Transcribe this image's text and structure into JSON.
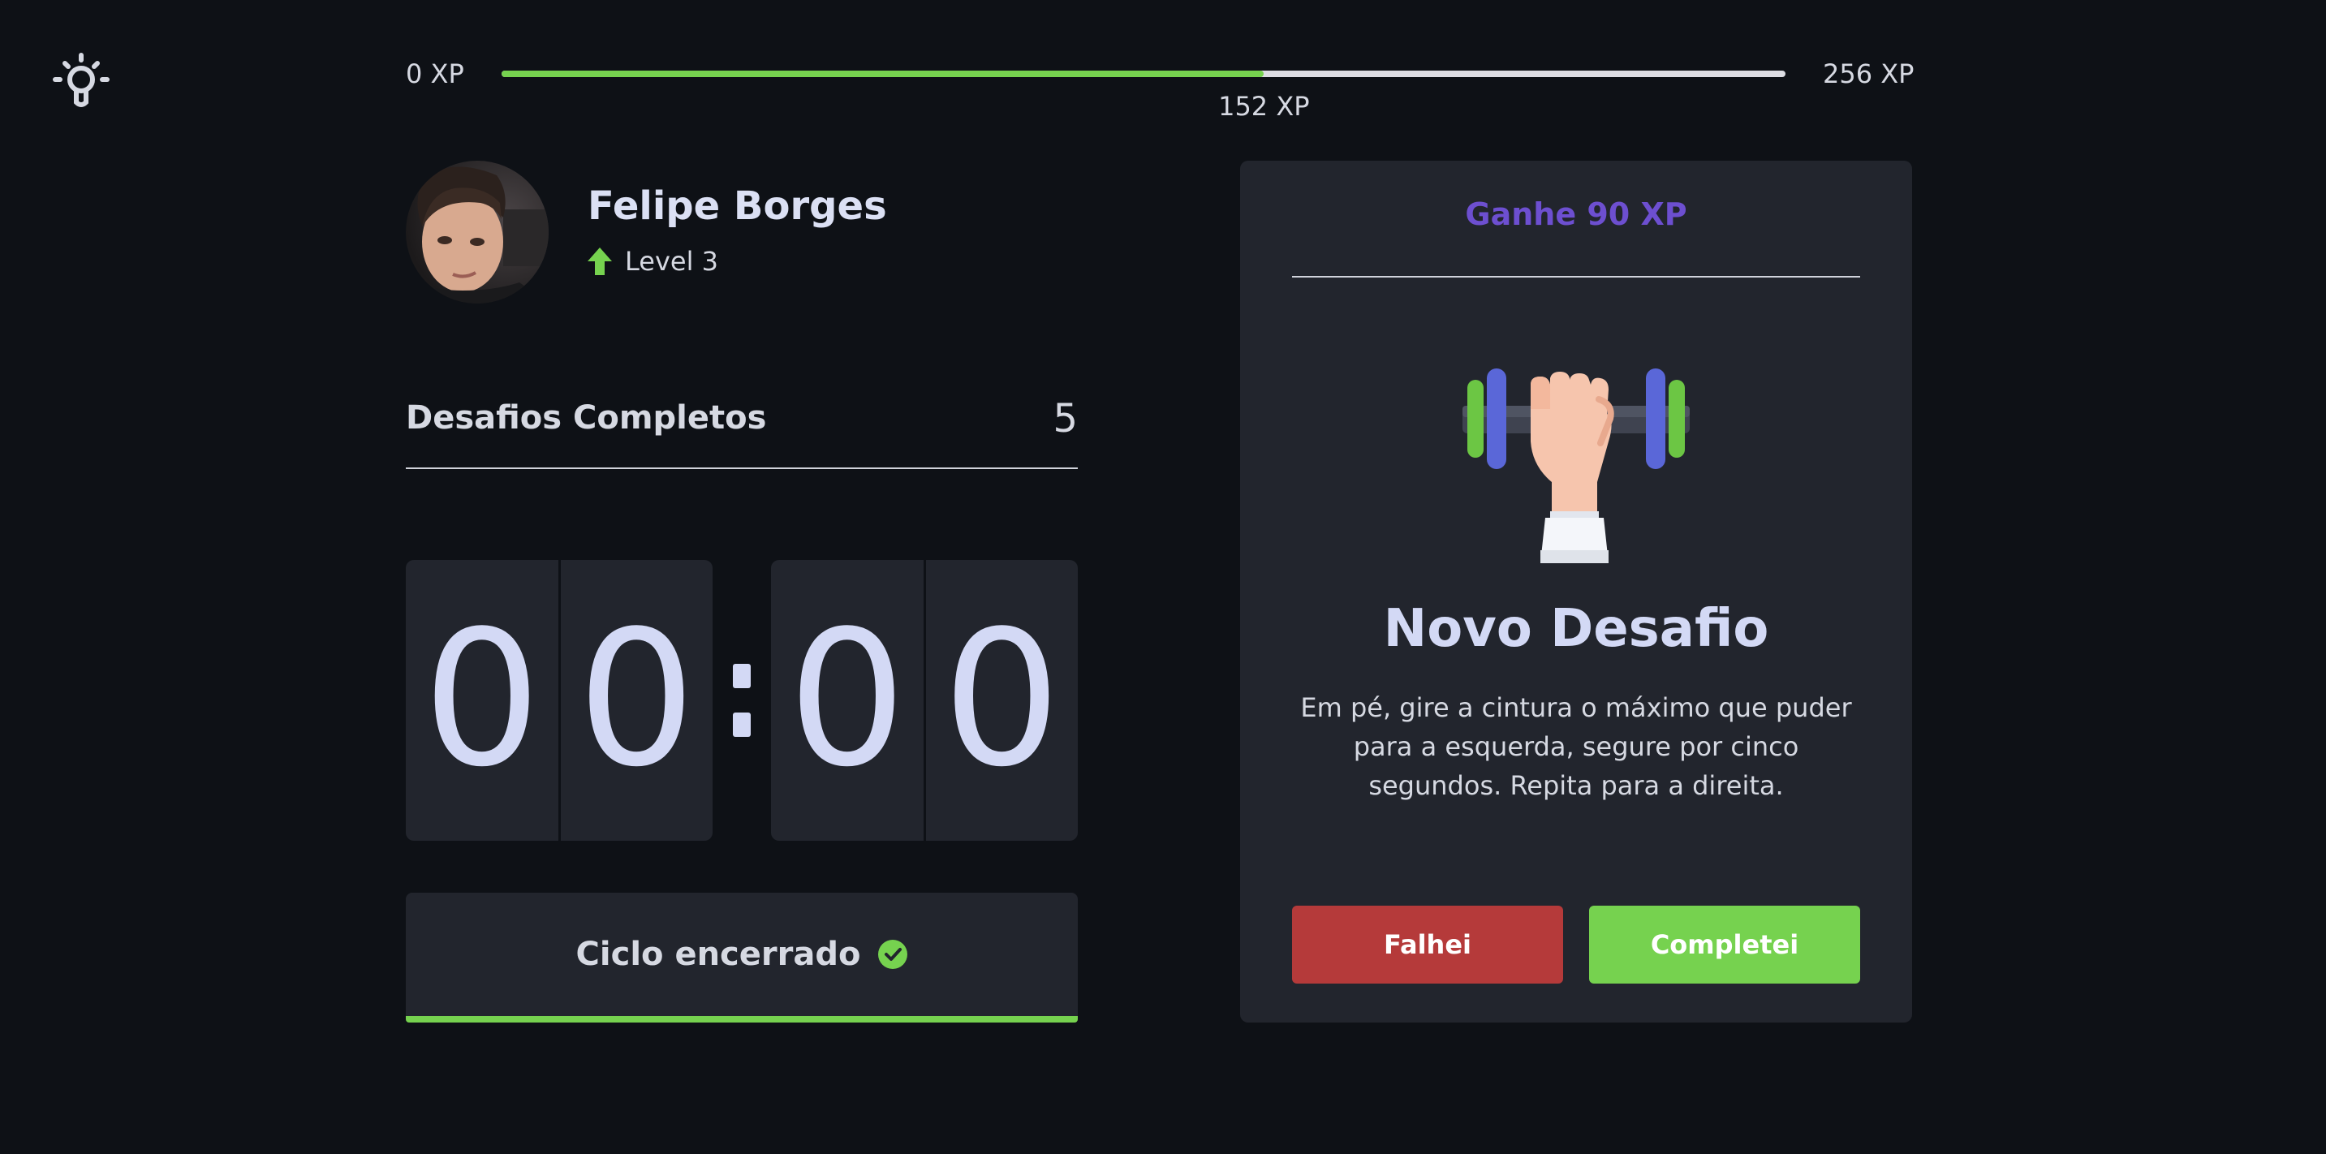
{
  "theme_toggle": {
    "icon": "lightbulb-icon"
  },
  "xp": {
    "min_label": "0 XP",
    "max_label": "256 XP",
    "current_label": "152 XP",
    "current": 152,
    "max": 256,
    "fill_color": "#76d24f",
    "track_color": "#dcdde3"
  },
  "profile": {
    "name": "Felipe Borges",
    "level_label": "Level 3",
    "level_icon": "up-arrow-icon",
    "avatar": "avatar-photo"
  },
  "stats": {
    "completed_label": "Desafios Completos",
    "completed_count": "5"
  },
  "countdown": {
    "minutes": [
      "0",
      "0"
    ],
    "seconds": [
      "0",
      "0"
    ]
  },
  "cycle": {
    "label": "Ciclo encerrado",
    "icon": "check-circle-icon",
    "accent": "#76d24f"
  },
  "challenge": {
    "reward": "Ganhe 90 XP",
    "reward_color": "#6d4fd0",
    "illustration": "dumbbell-icon",
    "title": "Novo Desafio",
    "description": "Em pé, gire a cintura o máximo que puder para a esquerda, segure por cinco segundos. Repita para a direita.",
    "fail_label": "Falhei",
    "fail_color": "#b53a3a",
    "success_label": "Completei",
    "success_color": "#76d24f"
  }
}
